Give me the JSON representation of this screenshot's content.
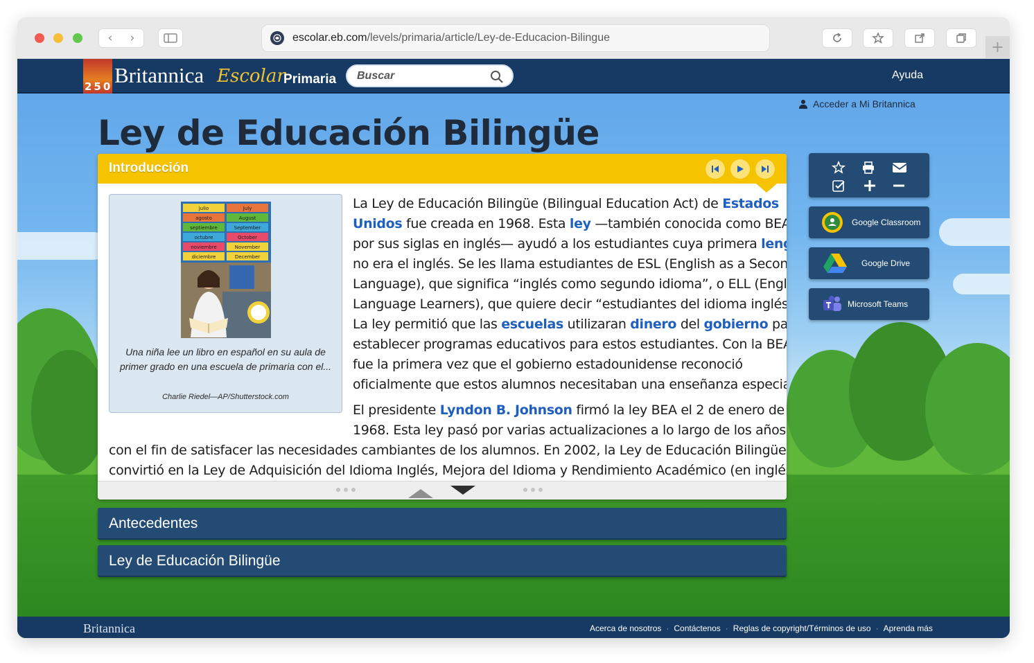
{
  "browser": {
    "url_host": "escolar.eb.com",
    "url_path": "/levels/primaria/article/Ley-de-Educacion-Bilingue"
  },
  "header": {
    "brand": "Britannica",
    "brand_sub": "Escolar",
    "brand_level": "Primaria",
    "brand_badge": "250",
    "search_placeholder": "Buscar",
    "help_label": "Ayuda",
    "login_label": "Acceder a Mi Britannica"
  },
  "article": {
    "title": "Ley de Educación Bilingüe",
    "section_label": "Introducción",
    "figure": {
      "caption": "Una niña lee un libro en español en su aula de primer grado en una escuela de primaria con el...",
      "credit": "Charlie Riedel—AP/Shutterstock.com",
      "calendar_months": [
        "julio",
        "agosto",
        "septiembre",
        "octubre",
        "noviembre",
        "diciembre"
      ],
      "calendar_months_en": [
        "July",
        "August",
        "September",
        "October",
        "November",
        "December"
      ]
    },
    "p1": {
      "l1a": "La Ley de Educación Bilingüe (Bilingual Education Act) de ",
      "l1link": "Estados",
      "l2link": "Unidos",
      "l2a": " fue creada en 1968. Esta ",
      "l2link2": "ley",
      "l2b": " —también conocida como BEA,",
      "l3a": "por sus siglas en inglés— ayudó a los estudiantes cuya primera ",
      "l3link": "lengua",
      "l4": "no era el inglés. Se les llama estudiantes de ESL (English as a Second",
      "l5": "Language), que significa “inglés como segundo idioma”, o ELL (English",
      "l6": "Language Learners), que quiere decir “estudiantes del idioma inglés”.",
      "l7a": "La ley permitió que las ",
      "l7link1": "escuelas",
      "l7b": " utilizaran ",
      "l7link2": "dinero",
      "l7c": " del ",
      "l7link3": "gobierno",
      "l7d": " para",
      "l8": "establecer programas educativos para estos estudiantes. Con la BEA,",
      "l9": "fue la primera vez que el gobierno estadounidense reconoció",
      "l10": "oficialmente que estos alumnos necesitaban una enseñanza especial."
    },
    "p2": {
      "l1a": "El presidente ",
      "l1link": "Lyndon B. Johnson",
      "l1b": " firmó la ley BEA el 2 de enero de",
      "l2": "1968. Esta ley pasó por varias actualizaciones a lo largo de los años",
      "l3": "con el fin de satisfacer las necesidades cambiantes de los alumnos. En 2002, la Ley de Educación Bilingüe se",
      "l4": "convirtió en la Ley de Adquisición del Idioma Inglés, Mejora del Idioma y Rendimiento Académico (en inglés,"
    },
    "sections": [
      "Antecedentes",
      "Ley de Educación Bilingüe"
    ]
  },
  "share": {
    "classroom": "Google Classroom",
    "drive": "Google Drive",
    "teams": "Microsoft Teams"
  },
  "footer": {
    "brand": "Britannica",
    "links": [
      "Acerca de nosotros",
      "Contáctenos",
      "Reglas de copyright/Términos de uso",
      "Aprenda más"
    ]
  },
  "colors": {
    "navy": "#163a63",
    "section_blue": "#244b73",
    "accent_yellow": "#f5c300",
    "link_blue": "#1f5fbf"
  }
}
